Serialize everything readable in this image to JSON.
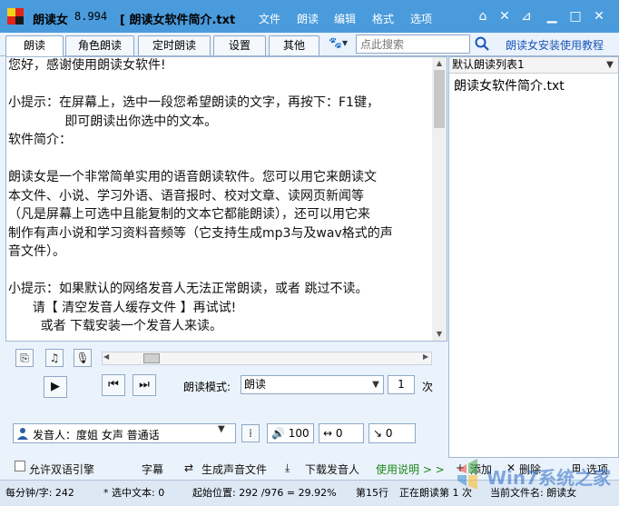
{
  "app": {
    "name": "朗读女",
    "version": "8.994",
    "doc_title": "[ 朗读女软件简介.txt"
  },
  "menu": [
    "文件",
    "朗读",
    "编辑",
    "格式",
    "选项"
  ],
  "tabs": [
    {
      "label": "朗读",
      "active": true
    },
    {
      "label": "角色朗读",
      "active": false
    },
    {
      "label": "定时朗读",
      "active": false
    },
    {
      "label": "设置",
      "active": false
    },
    {
      "label": "其他",
      "active": false
    }
  ],
  "search": {
    "placeholder": "点此搜索"
  },
  "tutorial_link": "朗读女安装使用教程",
  "text_lines": [
    "您好，感谢使用朗读女软件!",
    "",
    "小提示：在屏幕上，选中一段您希望朗读的文字，再按下：F1键，",
    "              即可朗读出你选中的文本。",
    "软件简介：",
    "",
    "朗读女是一个非常简单实用的语音朗读软件。您可以用它来朗读文",
    "本文件、小说、学习外语、语音报时、校对文章、读网页新闻等",
    "（凡是屏幕上可选中且能复制的文本它都能朗读），还可以用它来",
    "制作有声小说和学习资料音频等（它支持生成mp3与及wav格式的声",
    "音文件）。",
    "",
    "小提示：如果默认的网络发音人无法正常朗读，或者 跳过不读。",
    "      请【 清空发音人缓存文件 】再试试!",
    "        或者 下载安装一个发音人来读。"
  ],
  "playlist": {
    "header": "默认朗读列表1",
    "items": [
      "朗读女软件简介.txt"
    ]
  },
  "controls": {
    "mode_label": "朗读模式:",
    "mode_value": "朗读",
    "repeat_value": "1",
    "repeat_unit": "次",
    "voice": "发音人：度姐 女声 普通话",
    "volume": "100",
    "speed": "0",
    "pitch": "0"
  },
  "bottom": {
    "bilingual": "允许双语引擎",
    "subtitle": "字幕",
    "gen_audio": "生成声音文件",
    "download_voice": "下载发音人",
    "help": "使用说明 > >",
    "add": "添加",
    "delete": "删除",
    "options": "选项"
  },
  "status": {
    "per_min": "每分钟/字: 242",
    "selected": "* 选中文本: 0",
    "start_pos": "起始位置: 292 /976 = 29.92%",
    "line": "第15行",
    "reading": "正在朗读第 1 次",
    "current_file": "当前文件名: 朗读女"
  },
  "colors": {
    "titlebar": "#4a9bdc",
    "link": "#1a55b8",
    "help": "#1a8a1a"
  }
}
